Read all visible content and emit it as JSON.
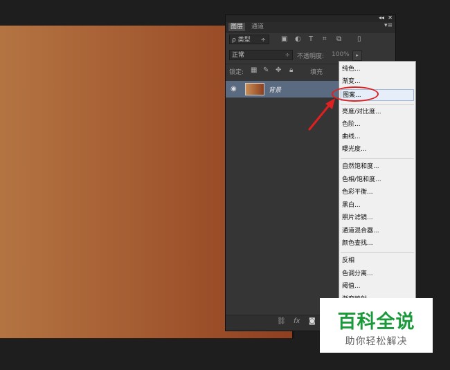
{
  "panel": {
    "collapse_glyph": "◂◂",
    "close_glyph": "✕",
    "tabs": [
      {
        "label": "图层"
      },
      {
        "label": "通道"
      }
    ],
    "panel_menu_glyph": "▾≡",
    "filter": {
      "label": "ρ 类型",
      "arrow": "÷"
    },
    "blend_mode": {
      "value": "正常",
      "arrow": "÷"
    },
    "opacity": {
      "label": "不透明度:",
      "value": "100%",
      "button": "▸"
    },
    "lock": {
      "label": "锁定:"
    },
    "fill": {
      "label": "填充"
    },
    "layers": [
      {
        "name": "背景"
      }
    ],
    "bottom_icons": [
      "link-icon",
      "fx-icon",
      "mask-icon"
    ],
    "bottom_fx": "fx"
  },
  "dropdown": {
    "items": [
      {
        "label": "纯色..."
      },
      {
        "label": "渐变..."
      },
      {
        "label": "图案..."
      },
      {
        "label": "亮度/对比度..."
      },
      {
        "label": "色阶..."
      },
      {
        "label": "曲线..."
      },
      {
        "label": "曝光度..."
      },
      {
        "label": "自然饱和度..."
      },
      {
        "label": "色相/饱和度..."
      },
      {
        "label": "色彩平衡..."
      },
      {
        "label": "黑白..."
      },
      {
        "label": "照片滤镜..."
      },
      {
        "label": "通道混合器..."
      },
      {
        "label": "颜色查找..."
      },
      {
        "label": "反相"
      },
      {
        "label": "色调分离..."
      },
      {
        "label": "阈值..."
      },
      {
        "label": "渐变映射..."
      }
    ],
    "highlighted": "图案..."
  },
  "annotation": {
    "circle_color": "#e02020",
    "arrow_color": "#e02020"
  },
  "watermark": {
    "title": "百科全说",
    "subtitle": "助你轻松解决"
  },
  "colors": {
    "canvas_left": "#b47442",
    "canvas_right": "#8f3f1f",
    "panel_bg": "#353535",
    "selected_layer": "#5a6a80",
    "watermark_green": "#1b9a3b"
  }
}
